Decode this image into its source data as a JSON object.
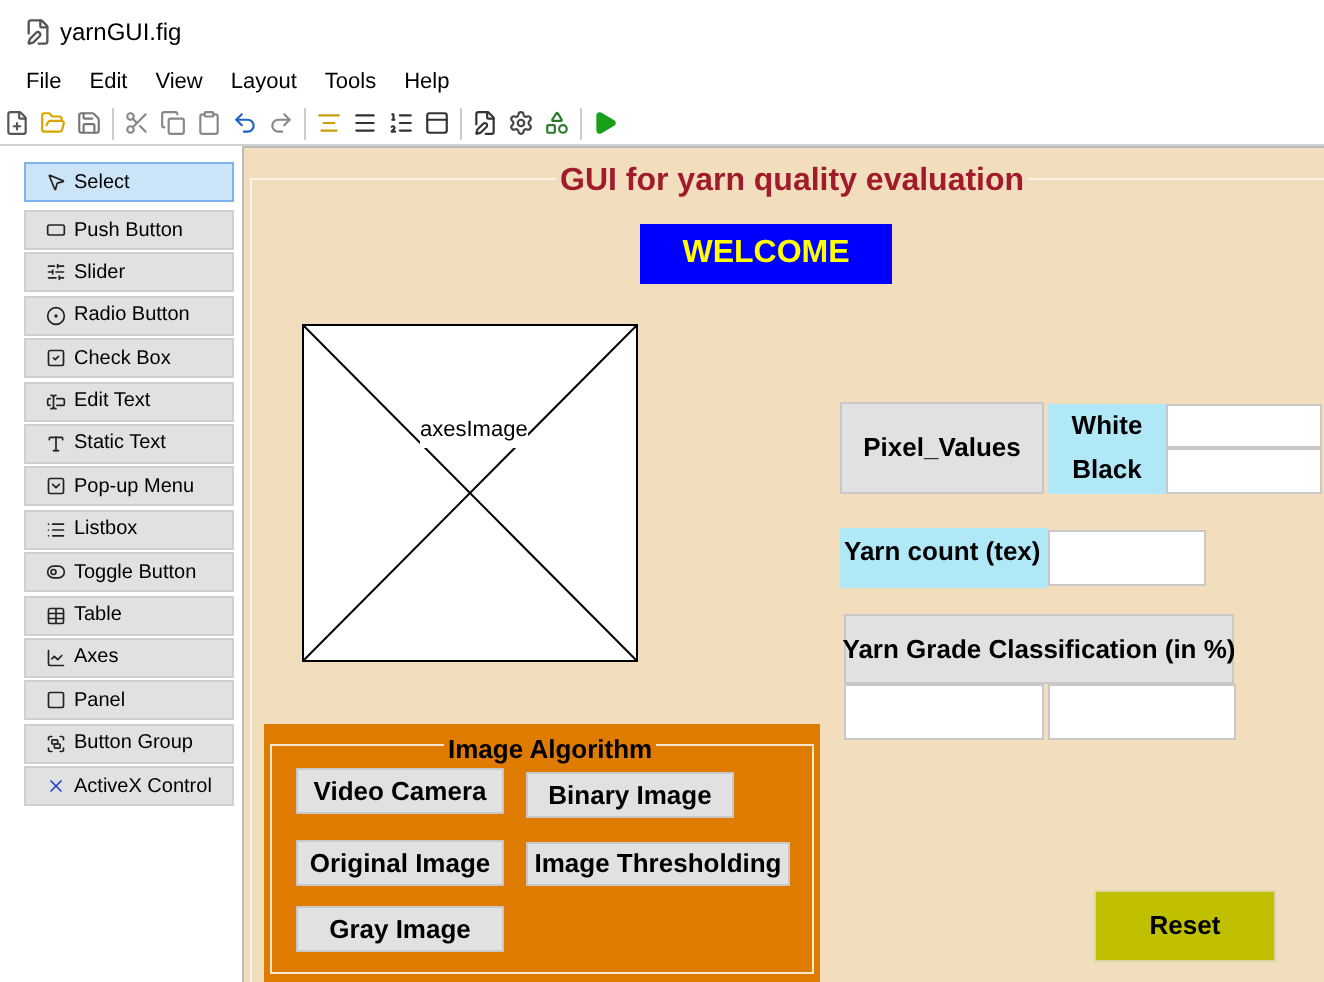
{
  "window": {
    "title": "yarnGUI.fig"
  },
  "menu": [
    "File",
    "Edit",
    "View",
    "Layout",
    "Tools",
    "Help"
  ],
  "palette": [
    {
      "label": "Select",
      "selected": true
    },
    {
      "label": "Push Button",
      "selected": false
    },
    {
      "label": "Slider",
      "selected": false
    },
    {
      "label": "Radio Button",
      "selected": false
    },
    {
      "label": "Check Box",
      "selected": false
    },
    {
      "label": "Edit Text",
      "selected": false
    },
    {
      "label": "Static Text",
      "selected": false
    },
    {
      "label": "Pop-up Menu",
      "selected": false
    },
    {
      "label": "Listbox",
      "selected": false
    },
    {
      "label": "Toggle Button",
      "selected": false
    },
    {
      "label": "Table",
      "selected": false
    },
    {
      "label": "Axes",
      "selected": false
    },
    {
      "label": "Panel",
      "selected": false
    },
    {
      "label": "Button Group",
      "selected": false
    },
    {
      "label": "ActiveX Control",
      "selected": false
    }
  ],
  "figure": {
    "title": "GUI for yarn quality evaluation",
    "banner": "WELCOME",
    "axes_label": "axesImage",
    "pixel_values": {
      "button": "Pixel_Values",
      "labels": [
        "White",
        "Black"
      ]
    },
    "yarn_count": {
      "label": "Yarn count (tex)"
    },
    "grade": {
      "header": "Yarn Grade Classification (in %)"
    },
    "algorithm_panel": {
      "title": "Image Algorithm",
      "buttons": [
        "Video Camera",
        "Binary Image",
        "Original Image",
        "Image Thresholding",
        "Gray Image"
      ]
    },
    "reset": "Reset"
  }
}
